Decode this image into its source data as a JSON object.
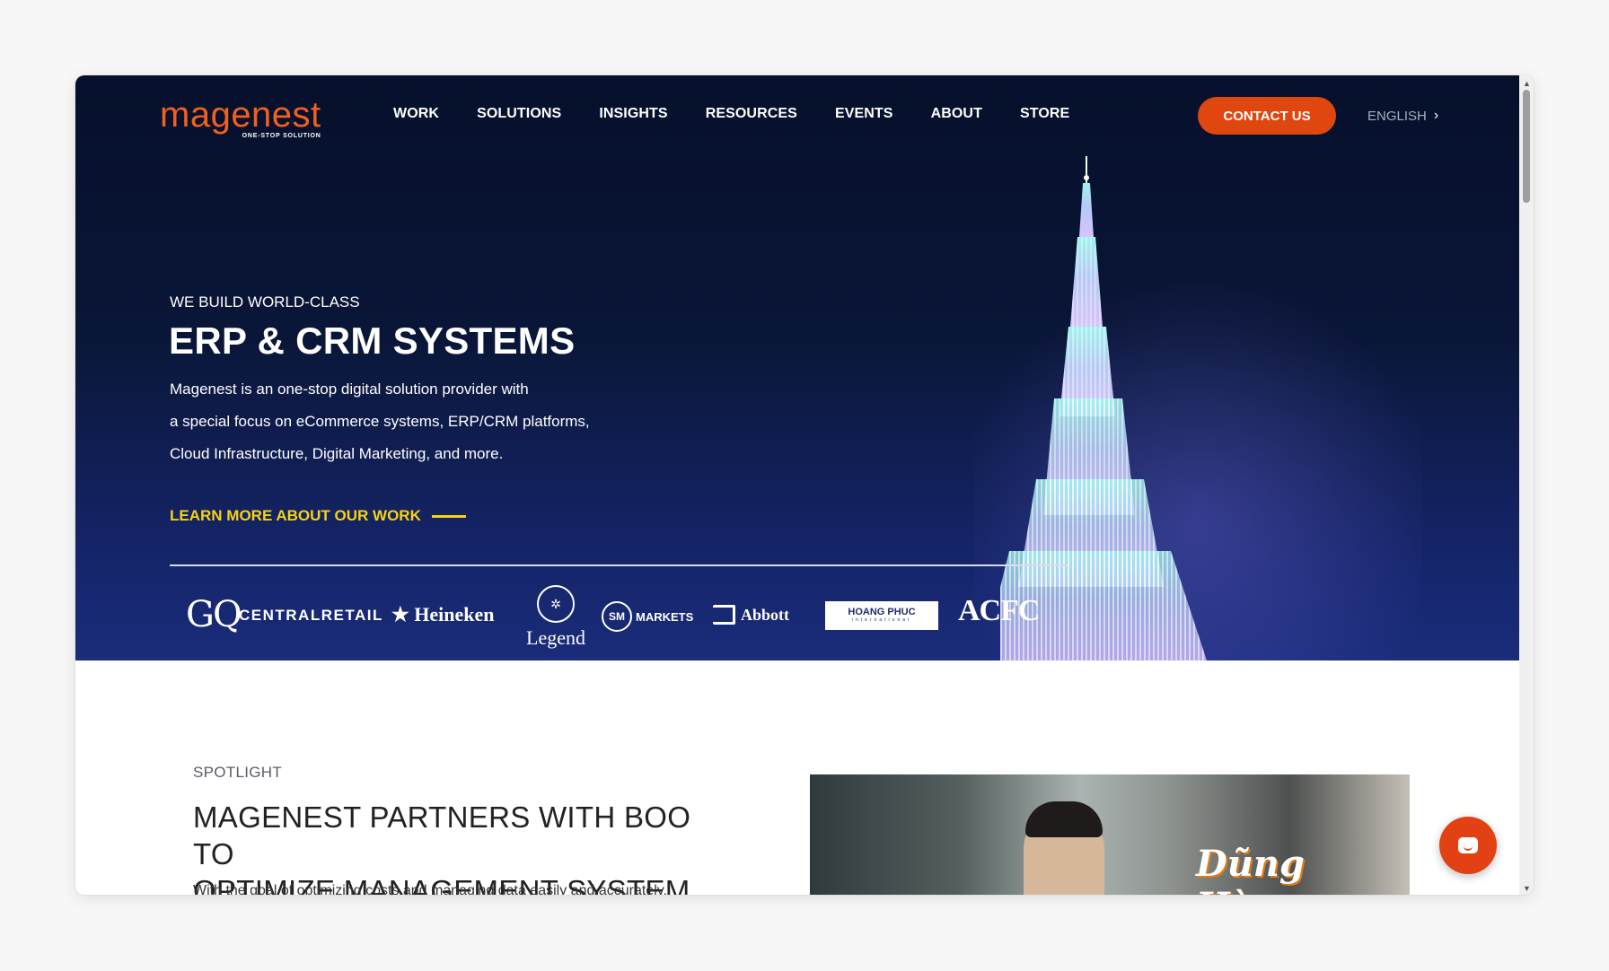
{
  "header": {
    "logo_text": "magenest",
    "logo_tagline": "ONE-STOP SOLUTION",
    "nav": [
      "WORK",
      "SOLUTIONS",
      "INSIGHTS",
      "RESOURCES",
      "EVENTS",
      "ABOUT",
      "STORE"
    ],
    "contact_label": "CONTACT US",
    "language_label": "ENGLISH",
    "accent_color": "#e0470f"
  },
  "hero": {
    "eyebrow": "WE BUILD WORLD-CLASS",
    "headline": "ERP & CRM SYSTEMS",
    "description_lines": [
      "Magenest is an one-stop digital solution provider with",
      "a special focus on eCommerce systems, ERP/CRM platforms,",
      "Cloud Infrastructure, Digital Marketing, and more."
    ],
    "cta_label": "LEARN MORE ABOUT OUR WORK",
    "cta_color": "#f6d313",
    "client_logos": {
      "gq": "GQ",
      "central": "CENTRALRETAIL",
      "heineken": "★ Heineken",
      "legend": "Legend",
      "sm": "SM",
      "sm_markets": "MARKETS",
      "abbott": "Abbott",
      "hoangphuc": "HOANG PHUC",
      "hoangphuc_sub": "international",
      "acfc": "ACFC"
    }
  },
  "spotlight": {
    "eyebrow": "SPOTLIGHT",
    "title_line1": "MAGENEST PARTNERS WITH BOO TO",
    "title_line2": "OPTIMIZE MANAGEMENT SYSTEM",
    "body": "With the goal of optimizing costs and managing data easily and accurately,",
    "thumbnail_caption": "Dũng Hàng"
  },
  "chat": {
    "icon": "chat-bubble-icon"
  }
}
